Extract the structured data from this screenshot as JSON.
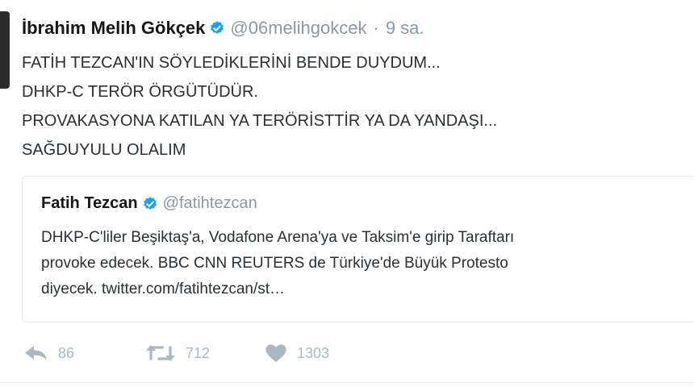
{
  "tweet": {
    "author_name": "İbrahim Melih Gökçek",
    "author_handle": "@06melihgokcek",
    "separator": "·",
    "time": "9 sa.",
    "verified": true,
    "lines": [
      "FATİH TEZCAN'IN SÖYLEDİKLERİNİ BENDE DUYDUM...",
      "DHKP-C TERÖR ÖRGÜTÜDÜR.",
      "PROVAKASYONA KATILAN YA TERÖRİSTTİR YA DA YANDAŞI...",
      "SAĞDUYULU OLALIM"
    ]
  },
  "quoted_tweet": {
    "author_name": "Fatih Tezcan",
    "author_handle": "@fatihtezcan",
    "verified": true,
    "lines": [
      "DHKP-C'liler Beşiktaş'a, Vodafone Arena'ya ve Taksim'e girip Taraftarı",
      "provoke edecek. BBC CNN REUTERS de Türkiye'de Büyük Protesto",
      "diyecek. twitter.com/fatihtezcan/st…"
    ]
  },
  "actions": {
    "reply_count": "86",
    "retweet_count": "712",
    "like_count": "1303"
  },
  "icons": {
    "verified": "verified-badge-icon",
    "reply": "reply-arrow-icon",
    "retweet": "retweet-icon",
    "like": "heart-icon"
  },
  "colors": {
    "verified_blue": "#1da1f2",
    "muted_gray": "#8899a6",
    "action_gray": "#aab8c2",
    "text": "#292f33"
  }
}
